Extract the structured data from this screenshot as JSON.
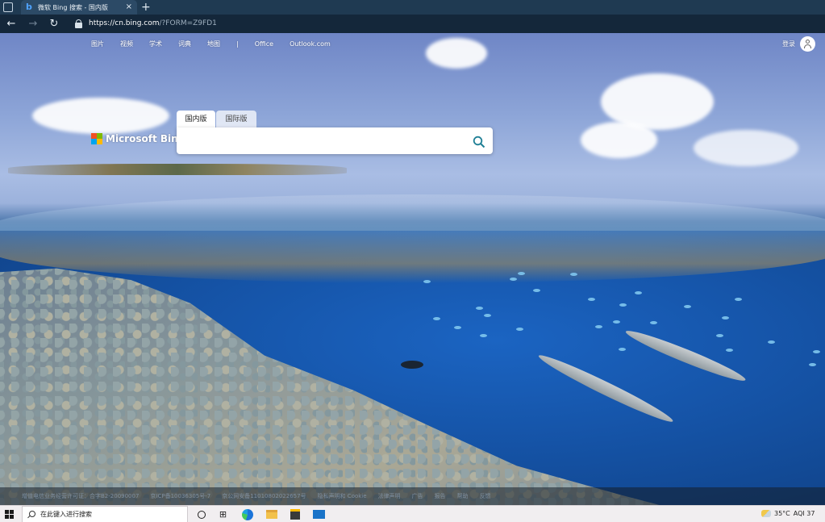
{
  "browser": {
    "tab_title": "微软 Bing 搜索 - 国内版",
    "tab_close_glyph": "×",
    "new_tab_glyph": "+",
    "url_host": "https://cn.bing.com",
    "url_path": "/?FORM=Z9FD1"
  },
  "topnav": {
    "items": [
      "图片",
      "视频",
      "学术",
      "词典",
      "地图",
      "|",
      "Office",
      "Outlook.com"
    ],
    "signin_label": "登录"
  },
  "logo": {
    "text": "Microsoft Bing",
    "colors": [
      "#f25022",
      "#7fba00",
      "#00a4ef",
      "#ffb900"
    ]
  },
  "search": {
    "scope_tabs": [
      "国内版",
      "国际版"
    ],
    "active_scope": "国内版",
    "value": "",
    "placeholder": "",
    "icon_color": "#1f7f95"
  },
  "footer": {
    "links": [
      "增值电信业务经营许可证：合字B2-20090007",
      "京ICP备10036305号-7",
      "京公网安备11010802022657号",
      "隐私声明和 Cookie",
      "法律声明",
      "广告",
      "报告",
      "帮助",
      "反馈"
    ]
  },
  "taskbar": {
    "search_placeholder": "在此键入进行搜索",
    "weather": {
      "temperature": "35°C",
      "aqi": "AQI 37"
    }
  }
}
